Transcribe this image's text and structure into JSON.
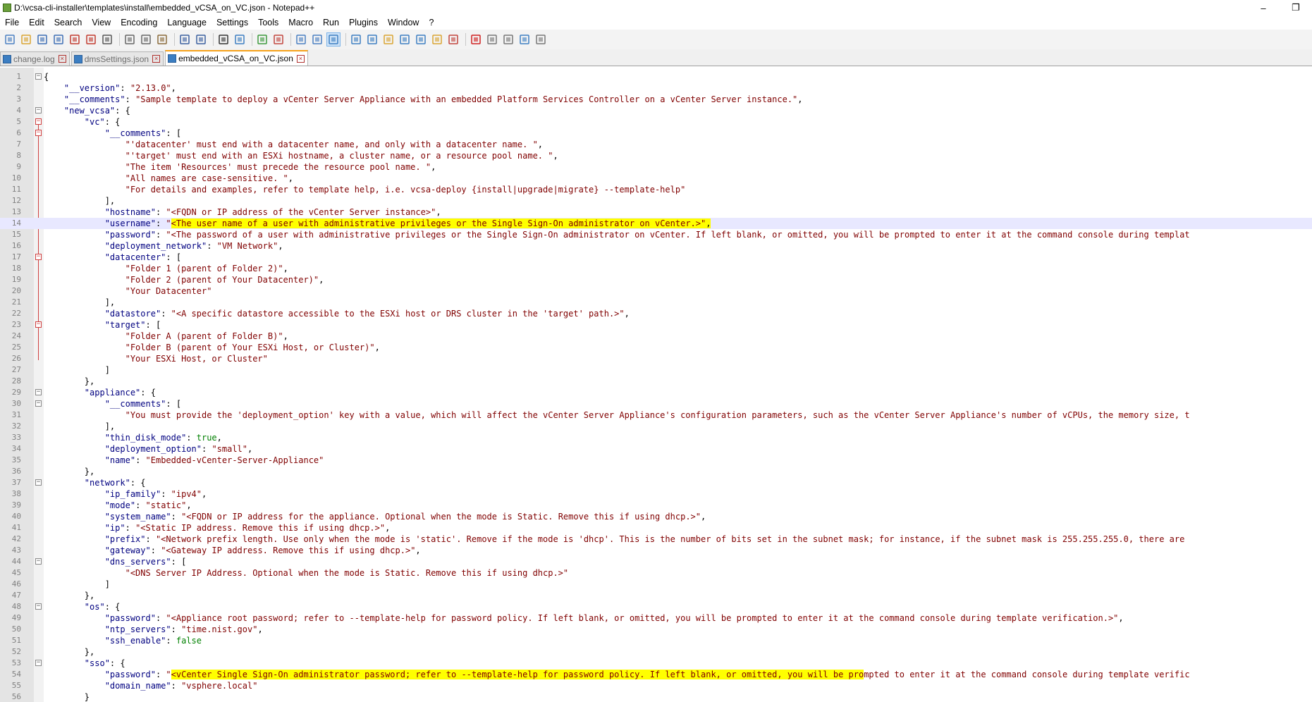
{
  "window": {
    "title": "D:\\vcsa-cli-installer\\templates\\install\\embedded_vCSA_on_VC.json - Notepad++",
    "minimize_glyph": "–",
    "restore_glyph": "❐"
  },
  "menu": [
    "File",
    "Edit",
    "Search",
    "View",
    "Encoding",
    "Language",
    "Settings",
    "Tools",
    "Macro",
    "Run",
    "Plugins",
    "Window",
    "?"
  ],
  "toolbar_icons": [
    "new-file-icon",
    "open-file-icon",
    "save-icon",
    "save-all-icon",
    "close-icon",
    "close-all-icon",
    "print-icon",
    "cut-icon",
    "copy-icon",
    "paste-icon",
    "undo-icon",
    "redo-icon",
    "find-icon",
    "replace-icon",
    "zoom-in-icon",
    "zoom-out-icon",
    "sync-vertical-icon",
    "sync-horizontal-icon",
    "word-wrap-icon",
    "show-all-chars-icon",
    "indent-guide-icon",
    "user-language-icon",
    "doc-map-icon",
    "function-list-icon",
    "folder-workspace-icon",
    "monitoring-icon",
    "record-macro-icon",
    "stop-macro-icon",
    "play-macro-icon",
    "run-macro-multiple-icon",
    "save-macro-icon"
  ],
  "tabs": [
    {
      "label": "change.log",
      "active": false
    },
    {
      "label": "dmsSettings.json",
      "active": false
    },
    {
      "label": "embedded_vCSA_on_VC.json",
      "active": true
    }
  ],
  "colors": {
    "highlight": "#ffff00",
    "key": "#000080",
    "string": "#800000",
    "keyword": "#008000",
    "tab_accent": "#f7a21b"
  },
  "lines": [
    {
      "n": "1",
      "fold": "minus",
      "t": [
        [
          "",
          "{"
        ]
      ]
    },
    {
      "n": "2",
      "t": [
        [
          "",
          "    "
        ],
        [
          "key",
          "\"__version\""
        ],
        [
          "",
          ": "
        ],
        [
          "str",
          "\"2.13.0\""
        ],
        [
          "",
          ","
        ]
      ]
    },
    {
      "n": "3",
      "t": [
        [
          "",
          "    "
        ],
        [
          "key",
          "\"__comments\""
        ],
        [
          "",
          ": "
        ],
        [
          "str",
          "\"Sample template to deploy a vCenter Server Appliance with an embedded Platform Services Controller on a vCenter Server instance.\""
        ],
        [
          "",
          ","
        ]
      ]
    },
    {
      "n": "4",
      "fold": "minus",
      "t": [
        [
          "",
          "    "
        ],
        [
          "key",
          "\"new_vcsa\""
        ],
        [
          "",
          ": {"
        ]
      ]
    },
    {
      "n": "5",
      "fold": "minus-red",
      "t": [
        [
          "",
          "        "
        ],
        [
          "key",
          "\"vc\""
        ],
        [
          "",
          ": {"
        ]
      ]
    },
    {
      "n": "6",
      "fold": "minus-red",
      "t": [
        [
          "",
          "            "
        ],
        [
          "key",
          "\"__comments\""
        ],
        [
          "",
          ": ["
        ]
      ]
    },
    {
      "n": "7",
      "t": [
        [
          "",
          "                "
        ],
        [
          "str",
          "\"'datacenter' must end with a datacenter name, and only with a datacenter name. \""
        ],
        [
          "",
          ","
        ]
      ]
    },
    {
      "n": "8",
      "t": [
        [
          "",
          "                "
        ],
        [
          "str",
          "\"'target' must end with an ESXi hostname, a cluster name, or a resource pool name. \""
        ],
        [
          "",
          ","
        ]
      ]
    },
    {
      "n": "9",
      "t": [
        [
          "",
          "                "
        ],
        [
          "str",
          "\"The item 'Resources' must precede the resource pool name. \""
        ],
        [
          "",
          ","
        ]
      ]
    },
    {
      "n": "10",
      "t": [
        [
          "",
          "                "
        ],
        [
          "str",
          "\"All names are case-sensitive. \""
        ],
        [
          "",
          ","
        ]
      ]
    },
    {
      "n": "11",
      "t": [
        [
          "",
          "                "
        ],
        [
          "str",
          "\"For details and examples, refer to template help, i.e. vcsa-deploy {install|upgrade|migrate} --template-help\""
        ]
      ]
    },
    {
      "n": "12",
      "t": [
        [
          "",
          "            ],"
        ]
      ]
    },
    {
      "n": "13",
      "t": [
        [
          "",
          "            "
        ],
        [
          "key",
          "\"hostname\""
        ],
        [
          "",
          ": "
        ],
        [
          "str",
          "\"<FQDN or IP address of the vCenter Server instance>\""
        ],
        [
          "",
          ","
        ]
      ]
    },
    {
      "n": "14",
      "current": true,
      "t": [
        [
          "",
          "            "
        ],
        [
          "key",
          "\"username\""
        ],
        [
          "",
          ": "
        ],
        [
          "str",
          "\""
        ],
        [
          "str hl",
          "<The user name of a user with administrative privileges or the Single Sign-On administrator on vCenter.>\""
        ],
        [
          "hl",
          ","
        ]
      ]
    },
    {
      "n": "15",
      "t": [
        [
          "",
          "            "
        ],
        [
          "key",
          "\"password\""
        ],
        [
          "",
          ": "
        ],
        [
          "str",
          "\"<The password of a user with administrative privileges or the Single Sign-On administrator on vCenter. If left blank, or omitted, you will be prompted to enter it at the command console during templat"
        ]
      ]
    },
    {
      "n": "16",
      "t": [
        [
          "",
          "            "
        ],
        [
          "key",
          "\"deployment_network\""
        ],
        [
          "",
          ": "
        ],
        [
          "str",
          "\"VM Network\""
        ],
        [
          "",
          ","
        ]
      ]
    },
    {
      "n": "17",
      "fold": "minus-red",
      "t": [
        [
          "",
          "            "
        ],
        [
          "key",
          "\"datacenter\""
        ],
        [
          "",
          ": ["
        ]
      ]
    },
    {
      "n": "18",
      "t": [
        [
          "",
          "                "
        ],
        [
          "str",
          "\"Folder 1 (parent of Folder 2)\""
        ],
        [
          "",
          ","
        ]
      ]
    },
    {
      "n": "19",
      "t": [
        [
          "",
          "                "
        ],
        [
          "str",
          "\"Folder 2 (parent of Your Datacenter)\""
        ],
        [
          "",
          ","
        ]
      ]
    },
    {
      "n": "20",
      "t": [
        [
          "",
          "                "
        ],
        [
          "str",
          "\"Your Datacenter\""
        ]
      ]
    },
    {
      "n": "21",
      "t": [
        [
          "",
          "            ],"
        ]
      ]
    },
    {
      "n": "22",
      "t": [
        [
          "",
          "            "
        ],
        [
          "key",
          "\"datastore\""
        ],
        [
          "",
          ": "
        ],
        [
          "str",
          "\"<A specific datastore accessible to the ESXi host or DRS cluster in the 'target' path.>\""
        ],
        [
          "",
          ","
        ]
      ]
    },
    {
      "n": "23",
      "fold": "minus-red",
      "t": [
        [
          "",
          "            "
        ],
        [
          "key",
          "\"target\""
        ],
        [
          "",
          ": ["
        ]
      ]
    },
    {
      "n": "24",
      "t": [
        [
          "",
          "                "
        ],
        [
          "str",
          "\"Folder A (parent of Folder B)\""
        ],
        [
          "",
          ","
        ]
      ]
    },
    {
      "n": "25",
      "t": [
        [
          "",
          "                "
        ],
        [
          "str",
          "\"Folder B (parent of Your ESXi Host, or Cluster)\""
        ],
        [
          "",
          ","
        ]
      ]
    },
    {
      "n": "26",
      "t": [
        [
          "",
          "                "
        ],
        [
          "str",
          "\"Your ESXi Host, or Cluster\""
        ]
      ]
    },
    {
      "n": "27",
      "t": [
        [
          "",
          "            ]"
        ]
      ]
    },
    {
      "n": "28",
      "t": [
        [
          "",
          "        },"
        ]
      ]
    },
    {
      "n": "29",
      "fold": "minus",
      "t": [
        [
          "",
          "        "
        ],
        [
          "key",
          "\"appliance\""
        ],
        [
          "",
          ": {"
        ]
      ]
    },
    {
      "n": "30",
      "fold": "minus",
      "t": [
        [
          "",
          "            "
        ],
        [
          "key",
          "\"__comments\""
        ],
        [
          "",
          ": ["
        ]
      ]
    },
    {
      "n": "31",
      "t": [
        [
          "",
          "                "
        ],
        [
          "str",
          "\"You must provide the 'deployment_option' key with a value, which will affect the vCenter Server Appliance's configuration parameters, such as the vCenter Server Appliance's number of vCPUs, the memory size, t"
        ]
      ]
    },
    {
      "n": "32",
      "t": [
        [
          "",
          "            ],"
        ]
      ]
    },
    {
      "n": "33",
      "t": [
        [
          "",
          "            "
        ],
        [
          "key",
          "\"thin_disk_mode\""
        ],
        [
          "",
          ": "
        ],
        [
          "kw",
          "true"
        ],
        [
          "",
          ","
        ]
      ]
    },
    {
      "n": "34",
      "t": [
        [
          "",
          "            "
        ],
        [
          "key",
          "\"deployment_option\""
        ],
        [
          "",
          ": "
        ],
        [
          "str",
          "\"small\""
        ],
        [
          "",
          ","
        ]
      ]
    },
    {
      "n": "35",
      "t": [
        [
          "",
          "            "
        ],
        [
          "key",
          "\"name\""
        ],
        [
          "",
          ": "
        ],
        [
          "str",
          "\"Embedded-vCenter-Server-Appliance\""
        ]
      ]
    },
    {
      "n": "36",
      "t": [
        [
          "",
          "        },"
        ]
      ]
    },
    {
      "n": "37",
      "fold": "minus",
      "t": [
        [
          "",
          "        "
        ],
        [
          "key",
          "\"network\""
        ],
        [
          "",
          ": {"
        ]
      ]
    },
    {
      "n": "38",
      "t": [
        [
          "",
          "            "
        ],
        [
          "key",
          "\"ip_family\""
        ],
        [
          "",
          ": "
        ],
        [
          "str",
          "\"ipv4\""
        ],
        [
          "",
          ","
        ]
      ]
    },
    {
      "n": "39",
      "t": [
        [
          "",
          "            "
        ],
        [
          "key",
          "\"mode\""
        ],
        [
          "",
          ": "
        ],
        [
          "str",
          "\"static\""
        ],
        [
          "",
          ","
        ]
      ]
    },
    {
      "n": "40",
      "t": [
        [
          "",
          "            "
        ],
        [
          "key",
          "\"system_name\""
        ],
        [
          "",
          ": "
        ],
        [
          "str",
          "\"<FQDN or IP address for the appliance. Optional when the mode is Static. Remove this if using dhcp.>\""
        ],
        [
          "",
          ","
        ]
      ]
    },
    {
      "n": "41",
      "t": [
        [
          "",
          "            "
        ],
        [
          "key",
          "\"ip\""
        ],
        [
          "",
          ": "
        ],
        [
          "str",
          "\"<Static IP address. Remove this if using dhcp.>\""
        ],
        [
          "",
          ","
        ]
      ]
    },
    {
      "n": "42",
      "t": [
        [
          "",
          "            "
        ],
        [
          "key",
          "\"prefix\""
        ],
        [
          "",
          ": "
        ],
        [
          "str",
          "\"<Network prefix length. Use only when the mode is 'static'. Remove if the mode is 'dhcp'. This is the number of bits set in the subnet mask; for instance, if the subnet mask is 255.255.255.0, there are"
        ]
      ]
    },
    {
      "n": "43",
      "t": [
        [
          "",
          "            "
        ],
        [
          "key",
          "\"gateway\""
        ],
        [
          "",
          ": "
        ],
        [
          "str",
          "\"<Gateway IP address. Remove this if using dhcp.>\""
        ],
        [
          "",
          ","
        ]
      ]
    },
    {
      "n": "44",
      "fold": "minus",
      "t": [
        [
          "",
          "            "
        ],
        [
          "key",
          "\"dns_servers\""
        ],
        [
          "",
          ": ["
        ]
      ]
    },
    {
      "n": "45",
      "t": [
        [
          "",
          "                "
        ],
        [
          "str",
          "\"<DNS Server IP Address. Optional when the mode is Static. Remove this if using dhcp.>\""
        ]
      ]
    },
    {
      "n": "46",
      "t": [
        [
          "",
          "            ]"
        ]
      ]
    },
    {
      "n": "47",
      "t": [
        [
          "",
          "        },"
        ]
      ]
    },
    {
      "n": "48",
      "fold": "minus",
      "t": [
        [
          "",
          "        "
        ],
        [
          "key",
          "\"os\""
        ],
        [
          "",
          ": {"
        ]
      ]
    },
    {
      "n": "49",
      "t": [
        [
          "",
          "            "
        ],
        [
          "key",
          "\"password\""
        ],
        [
          "",
          ": "
        ],
        [
          "str",
          "\"<Appliance root password; refer to --template-help for password policy. If left blank, or omitted, you will be prompted to enter it at the command console during template verification.>\""
        ],
        [
          "",
          ","
        ]
      ]
    },
    {
      "n": "50",
      "t": [
        [
          "",
          "            "
        ],
        [
          "key",
          "\"ntp_servers\""
        ],
        [
          "",
          ": "
        ],
        [
          "str",
          "\"time.nist.gov\""
        ],
        [
          "",
          ","
        ]
      ]
    },
    {
      "n": "51",
      "t": [
        [
          "",
          "            "
        ],
        [
          "key",
          "\"ssh_enable\""
        ],
        [
          "",
          ": "
        ],
        [
          "kw",
          "false"
        ]
      ]
    },
    {
      "n": "52",
      "t": [
        [
          "",
          "        },"
        ]
      ]
    },
    {
      "n": "53",
      "fold": "minus",
      "t": [
        [
          "",
          "        "
        ],
        [
          "key",
          "\"sso\""
        ],
        [
          "",
          ": {"
        ]
      ]
    },
    {
      "n": "54",
      "t": [
        [
          "",
          "            "
        ],
        [
          "key",
          "\"password\""
        ],
        [
          "",
          ": "
        ],
        [
          "str",
          "\""
        ],
        [
          "str hl",
          "<vCenter Single Sign-On administrator password; refer to --template-help for password policy. If left blank, or omitted, you will be pro"
        ],
        [
          "str",
          "mpted to enter it at the command console during template verific"
        ]
      ]
    },
    {
      "n": "55",
      "t": [
        [
          "",
          "            "
        ],
        [
          "key",
          "\"domain_name\""
        ],
        [
          "",
          ": "
        ],
        [
          "str",
          "\"vsphere.local\""
        ]
      ]
    },
    {
      "n": "56",
      "t": [
        [
          "",
          "        }"
        ]
      ]
    }
  ]
}
